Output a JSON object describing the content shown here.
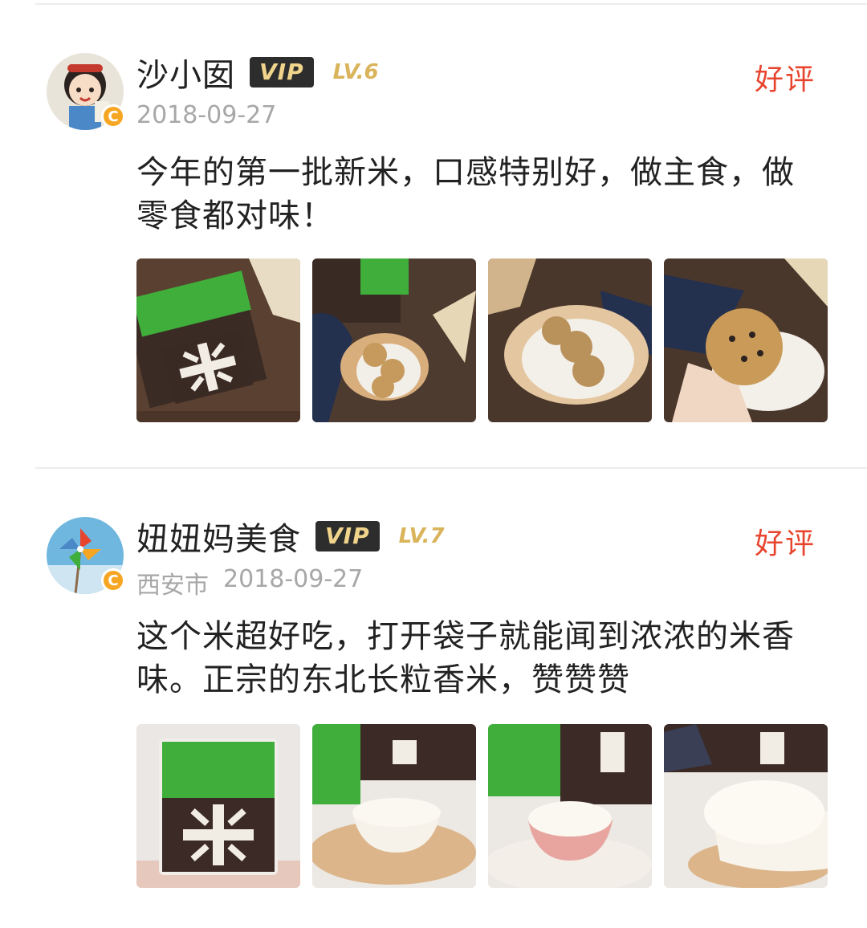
{
  "reviews": [
    {
      "username": "沙小囡",
      "vip_label": "VIP",
      "level": "LV.6",
      "rating": "好评",
      "location": "",
      "date": "2018-09-27",
      "comment": "今年的第一批新米，口感特别好，做主食，做零食都对味！",
      "badge_letter": "C",
      "images": [
        {
          "name": "rice-bag-photo"
        },
        {
          "name": "rice-cracker-photo"
        },
        {
          "name": "rice-cracker-plate-photo"
        },
        {
          "name": "rice-cracker-hand-photo"
        }
      ]
    },
    {
      "username": "妞妞妈美食",
      "vip_label": "VIP",
      "level": "LV.7",
      "rating": "好评",
      "location": "西安市",
      "date": "2018-09-27",
      "comment": "这个米超好吃，打开袋子就能闻到浓浓的米香味。正宗的东北长粒香米，赞赞赞",
      "badge_letter": "C",
      "images": [
        {
          "name": "rice-bag-photo"
        },
        {
          "name": "rice-bowl-photo"
        },
        {
          "name": "rice-bowl-photo"
        },
        {
          "name": "rice-bowl-closeup-photo"
        }
      ]
    }
  ],
  "colors": {
    "rating": "#e8452e",
    "vip_bg": "#2d2d2d",
    "vip_text": "#f0d48b",
    "level": "#d9b45a",
    "meta": "#a7a7a7",
    "badge": "#f6a623"
  }
}
